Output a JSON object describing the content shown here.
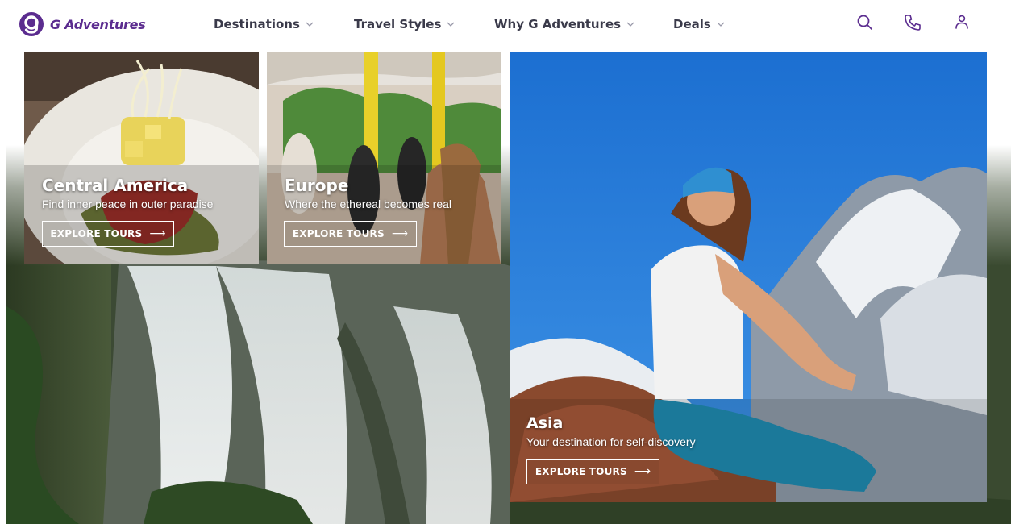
{
  "header": {
    "brand": "G Adventures",
    "nav": [
      {
        "label": "Destinations"
      },
      {
        "label": "Travel Styles"
      },
      {
        "label": "Why G Adventures"
      },
      {
        "label": "Deals"
      }
    ],
    "icons": [
      "search-icon",
      "phone-icon",
      "account-icon"
    ]
  },
  "cards": [
    {
      "title": "Central America",
      "subtitle": "Find inner peace in outer paradise",
      "cta": "EXPLORE TOURS"
    },
    {
      "title": "Europe",
      "subtitle": "Where the ethereal becomes real",
      "cta": "EXPLORE TOURS"
    },
    {
      "title": "Asia",
      "subtitle": "Your destination for self-discovery",
      "cta": "EXPLORE TOURS"
    }
  ],
  "colors": {
    "brand": "#5b2c8f",
    "nav_text": "#3a3a4a",
    "card_text": "#ffffff"
  }
}
